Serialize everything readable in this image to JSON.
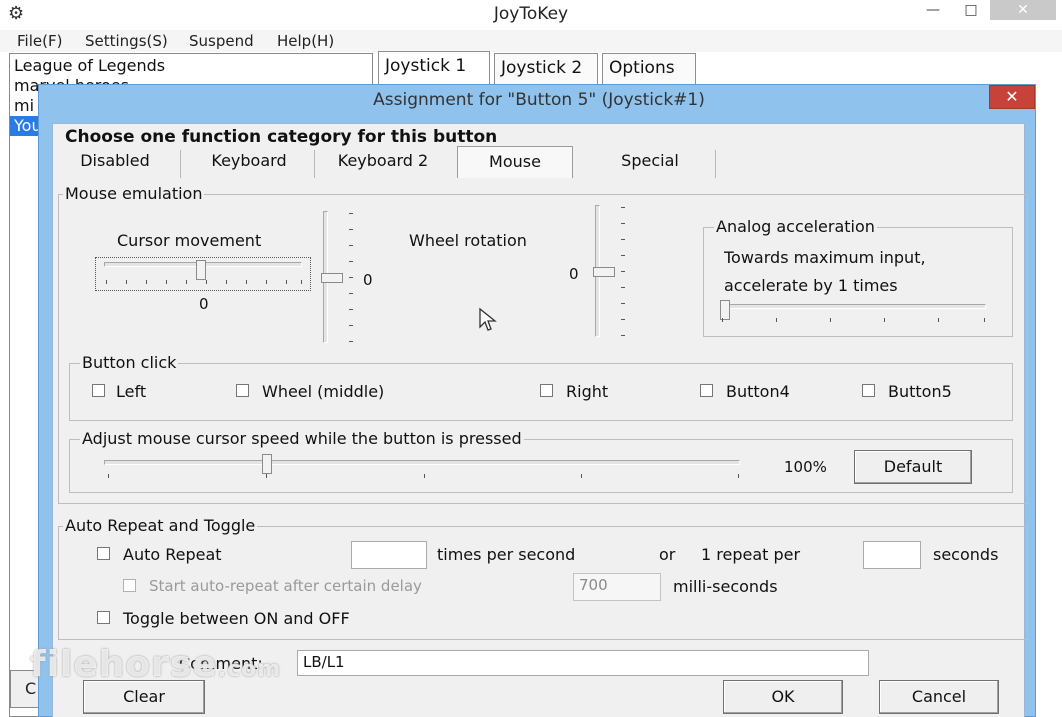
{
  "main_window": {
    "title": "JoyToKey",
    "controls": {
      "minimize": "—",
      "maximize": "□",
      "close": "✕"
    },
    "menu": [
      "File(F)",
      "Settings(S)",
      "Suspend",
      "Help(H)"
    ],
    "profiles": [
      "League of Legends",
      "marvel heroes",
      "mi",
      "You"
    ],
    "selected_profile_index": 3,
    "tabs": [
      "Joystick 1",
      "Joystick 2",
      "Options"
    ],
    "active_tab": "Joystick 1",
    "hidden_button_fragment": "C"
  },
  "dialog": {
    "title": "Assignment for \"Button 5\" (Joystick#1)",
    "close_label": "✕",
    "choose_label": "Choose one function category for this button",
    "categories": [
      "Disabled",
      "Keyboard",
      "Keyboard 2",
      "Mouse",
      "Special"
    ],
    "active_category": "Mouse",
    "mouse_emulation": {
      "group_label": "Mouse emulation",
      "cursor_movement": {
        "label": "Cursor movement",
        "horizontal_value": "0",
        "vertical_value": "0"
      },
      "wheel_rotation": {
        "label": "Wheel rotation",
        "value": "0"
      },
      "analog_acceleration": {
        "group_label": "Analog acceleration",
        "line1": "Towards maximum input,",
        "line2": "accelerate by 1 times",
        "level": 0
      },
      "button_click": {
        "group_label": "Button click",
        "options": [
          "Left",
          "Wheel (middle)",
          "Right",
          "Button4",
          "Button5"
        ]
      },
      "cursor_speed": {
        "group_label": "Adjust mouse cursor speed while the button is pressed",
        "value_text": "100%",
        "level": 0.25,
        "default_button": "Default"
      }
    },
    "auto_repeat": {
      "group_label": "Auto Repeat and Toggle",
      "auto_repeat_label": "Auto Repeat",
      "times_per_second_label": "times per second",
      "or_label": "or",
      "one_repeat_per_label": "1 repeat per",
      "seconds_label": "seconds",
      "times_value": "",
      "seconds_value": "",
      "delay_label": "Start auto-repeat after certain delay",
      "delay_value": "700",
      "ms_label": "milli-seconds",
      "toggle_label": "Toggle between ON and OFF"
    },
    "comment_label": "Comment:",
    "comment_value": "LB/L1",
    "buttons": {
      "clear": "Clear",
      "ok": "OK",
      "cancel": "Cancel"
    }
  },
  "watermark": {
    "text": "filehorse",
    "suffix": ".com"
  },
  "colors": {
    "dialog_frame": "#8fc3ee",
    "selection": "#2b7be4",
    "dialog_close": "#c7433a"
  }
}
